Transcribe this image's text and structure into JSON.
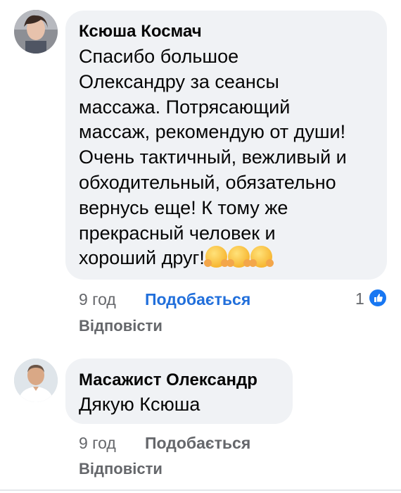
{
  "comments": [
    {
      "author": "Ксюша Космач",
      "lines": [
        "Спасибо большое",
        "Олександру за сеансы",
        "массажа. Потрясающий",
        "массаж, рекомендую от души!",
        "Очень тактичный, вежливый и",
        "обходительный, обязательно",
        "вернусь еще! К тому же",
        "прекрасный человек и",
        "хороший друг!"
      ],
      "emoji_icon": "smiling-face-with-hugging-hands-icon",
      "emoji_count": 3,
      "time": "9 год",
      "like_label": "Подобається",
      "like_active": true,
      "reply_label": "Відповісти",
      "reaction_count": "1"
    },
    {
      "author": "Масажист Олександр",
      "lines": [
        "Дякую Ксюша"
      ],
      "time": "9 год",
      "like_label": "Подобається",
      "like_active": false,
      "reply_label": "Відповісти"
    }
  ],
  "colors": {
    "bubble": "#f0f2f5",
    "meta_gray": "#65676b",
    "like_blue": "#216fdb",
    "reaction_blue": "#1877f2"
  }
}
